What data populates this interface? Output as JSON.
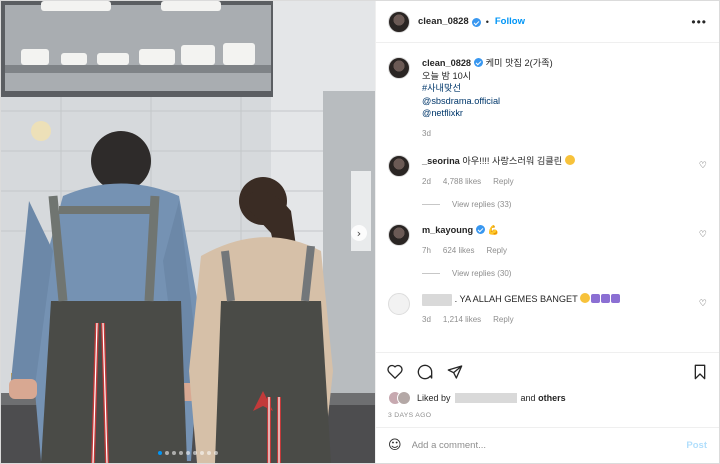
{
  "post": {
    "username": "clean_0828",
    "follow_label": "Follow",
    "caption_lines": [
      "케미 맛집 2(가족)",
      "오늘 밤 10시",
      "#사내맞선",
      "@sbsdrama.official",
      "@netflixkr"
    ],
    "time": "3d"
  },
  "photo": {
    "carousel_dots": 9,
    "active_dot": 0
  },
  "comments": [
    {
      "username": "_seorina",
      "text": "아우!!!! 사랑스러워 김클린",
      "time": "2d",
      "likes": "4,788 likes",
      "reply": "Reply",
      "view_replies": "View replies (33)"
    },
    {
      "username": "m_kayoung",
      "text": "",
      "time": "7h",
      "likes": "624 likes",
      "reply": "Reply",
      "view_replies": "View replies (30)"
    },
    {
      "username": "",
      "text": ". YA ALLAH GEMES BANGET",
      "time": "3d",
      "likes": "1,214 likes",
      "reply": "Reply"
    }
  ],
  "likes": {
    "prefix": "Liked by",
    "and_others": "and",
    "others": "others"
  },
  "date": "3 DAYS AGO",
  "add_comment": {
    "placeholder": "Add a comment...",
    "post_label": "Post"
  },
  "colors": {
    "accent": "#0095f6",
    "verified": "#3897f0"
  },
  "icons": [
    "heart-icon",
    "comment-icon",
    "share-icon",
    "bookmark-icon",
    "emoji-icon",
    "more-icon",
    "chevron-right-icon",
    "verified-icon",
    "flexed-biceps-icon"
  ]
}
